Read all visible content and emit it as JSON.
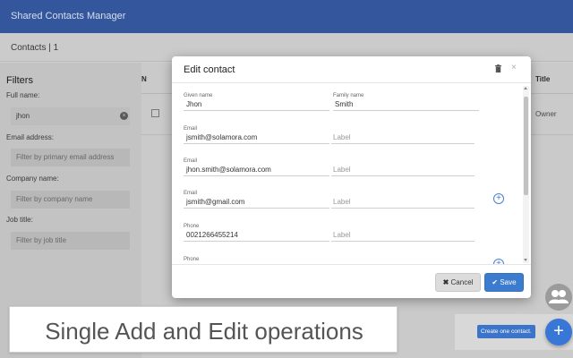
{
  "app": {
    "title": "Shared Contacts Manager",
    "contacts_count": "Contacts | 1"
  },
  "filters": {
    "title": "Filters",
    "full_name_label": "Full name:",
    "full_name_value": "jhon",
    "email_label": "Email address:",
    "email_placeholder": "Filter by primary email address",
    "company_label": "Company name:",
    "company_placeholder": "Filter by company name",
    "job_label": "Job title:",
    "job_placeholder": "Filter by job title"
  },
  "table": {
    "header_n": "N",
    "header_title": "Title",
    "row_role": "Owner"
  },
  "modal": {
    "title": "Edit contact",
    "given_name_label": "Given name",
    "given_name_value": "Jhon",
    "family_name_label": "Family name",
    "family_name_value": "Smith",
    "email_label": "Email",
    "label_placeholder": "Label",
    "emails": [
      "jsmith@solamora.com",
      "jhon.smith@solamora.com",
      "jsmith@gmail.com"
    ],
    "phone_label": "Phone",
    "phones": [
      "0021266455214"
    ],
    "cancel_label": "Cancel",
    "save_label": "Save"
  },
  "caption": "Single Add and Edit operations",
  "create_tooltip": "Create one contact.",
  "fab_label": "+",
  "colors": {
    "header_bg": "#34569d",
    "primary_button": "#3b7ccf",
    "fab": "#3877d6"
  }
}
